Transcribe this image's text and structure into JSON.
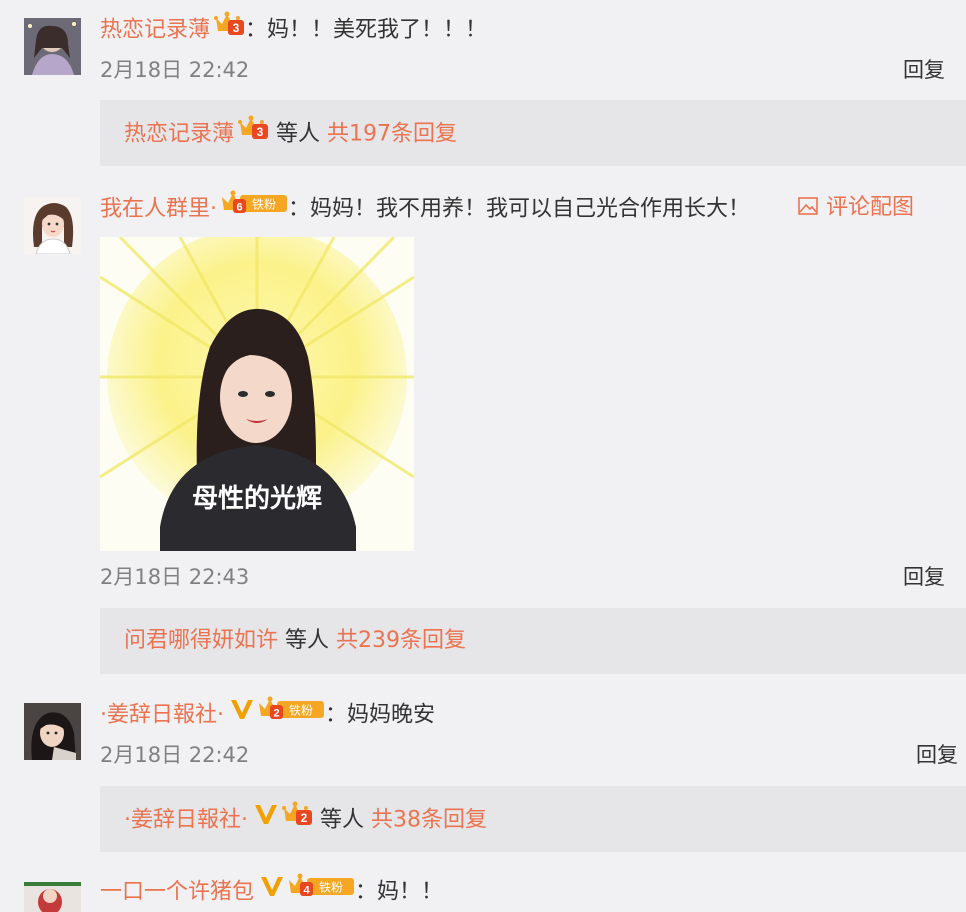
{
  "comments": [
    {
      "username": "热恋记录薄",
      "colon": "：",
      "text": "妈！！美死我了！！！",
      "badge_level": "3",
      "time": "2月18日 22:42",
      "reply_label": "回复",
      "sub": {
        "username": "热恋记录薄",
        "badge_level": "3",
        "deng": "等人",
        "count": "共197条回复"
      }
    },
    {
      "username": "我在人群里·",
      "colon": "：",
      "text": "妈妈！我不用养！我可以自己光合作用长大！",
      "badge_level": "6",
      "fan_label": "铁粉",
      "pic_label": "评论配图",
      "image_caption": "母性的光辉",
      "time": "2月18日 22:43",
      "reply_label": "回复",
      "sub": {
        "username": "问君哪得妍如许",
        "deng": "等人",
        "count": "共239条回复"
      }
    },
    {
      "username": "·姜辞日報社·",
      "colon": "：",
      "text": "妈妈晚安",
      "badge_level": "2",
      "fan_label": "铁粉",
      "time": "2月18日 22:42",
      "reply_label": "回复",
      "sub": {
        "username": "·姜辞日報社·",
        "badge_level": "2",
        "deng": "等人",
        "count": "共38条回复"
      }
    },
    {
      "username": "一口一个许猪包",
      "colon": "：",
      "text": "妈！！",
      "badge_level": "4",
      "fan_label": "铁粉"
    }
  ],
  "colors": {
    "accent": "#eb7350",
    "badge_gold": "#f5a623",
    "verified": "#f2a000",
    "background": "#f1f1f3",
    "subbox": "#e6e6e8"
  },
  "icons": {
    "vip_badge": "crown-badge-icon",
    "verified": "verified-v-icon",
    "picture": "image-icon"
  }
}
